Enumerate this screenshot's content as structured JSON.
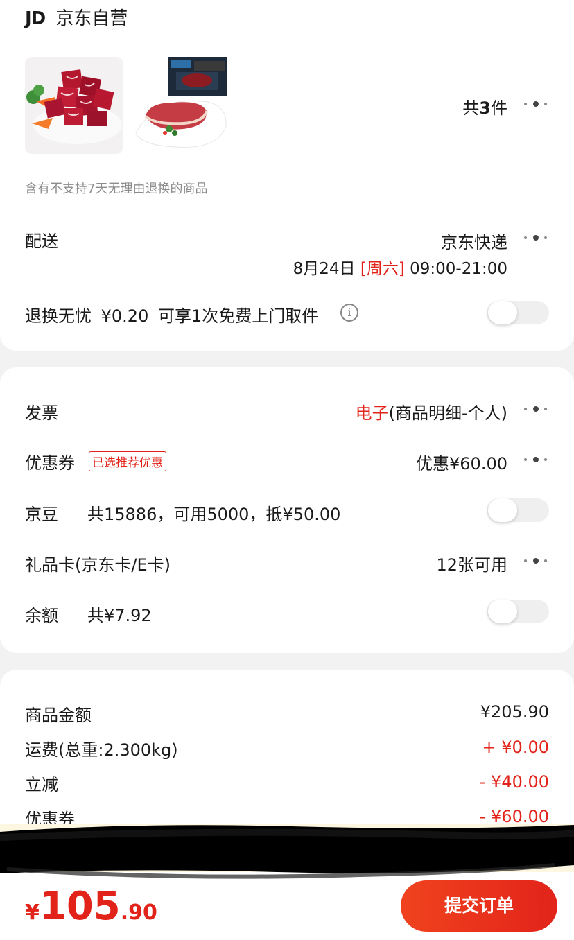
{
  "store": {
    "logo": "JD",
    "name": "京东自营"
  },
  "products": {
    "items": [
      {
        "name": "beef-cubes-image"
      },
      {
        "name": "steak-image"
      }
    ],
    "count_prefix": "共",
    "count_value": "3",
    "count_suffix": "件",
    "notice": "含有不支持7天无理由退换的商品"
  },
  "delivery": {
    "label": "配送",
    "carrier": "京东快递",
    "date": "8月24日",
    "weekday": "[周六]",
    "time": "09:00-21:00"
  },
  "return_service": {
    "label": "退换无忧",
    "price": "¥0.20",
    "desc": "可享1次免费上门取件"
  },
  "invoice": {
    "label": "发票",
    "type": "电子",
    "detail": "(商品明细-个人)"
  },
  "coupon": {
    "label": "优惠券",
    "tag": "已选推荐优惠",
    "value": "优惠¥60.00"
  },
  "jingdou": {
    "label": "京豆",
    "desc": "共15886，可用5000，抵¥50.00"
  },
  "giftcard": {
    "label": "礼品卡(京东卡/E卡)",
    "value": "12张可用"
  },
  "balance": {
    "label": "余额",
    "desc": "共¥7.92"
  },
  "summary": {
    "rows": [
      {
        "label": "商品金额",
        "value": "¥205.90"
      },
      {
        "label": "运费(总重:2.300kg)",
        "value": "+ ¥0.00"
      },
      {
        "label": "立减",
        "value": "-  ¥40.00"
      },
      {
        "label": "优惠券",
        "value": "-  ¥60.00"
      }
    ]
  },
  "footer": {
    "currency": "¥",
    "total_int": "105",
    "total_dec": ".90",
    "submit_label": "提交订单"
  },
  "colors": {
    "accent": "#e2231a",
    "background": "#f2f2f2"
  }
}
